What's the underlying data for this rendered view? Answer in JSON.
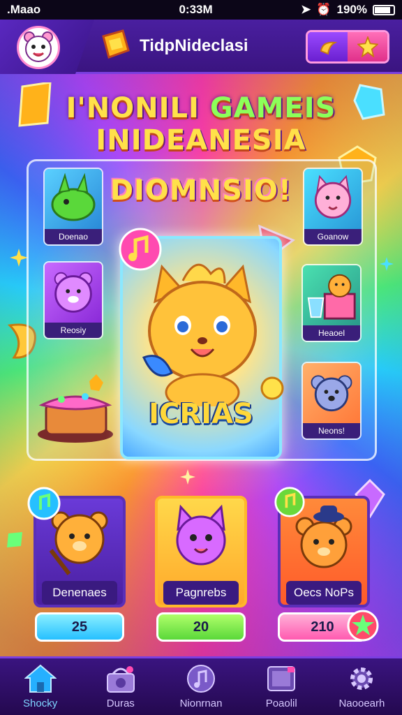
{
  "status_bar": {
    "carrier": ".Maao",
    "time": "0:33M",
    "battery": "190%"
  },
  "header": {
    "title": "TidpNideclasi"
  },
  "banner": {
    "line1_a": "I'NONILI ",
    "line1_b": "GAMEIS",
    "line2": "INIDEANESIA",
    "line3": "DIOMNSIO!"
  },
  "side_cards": [
    {
      "label": "Doenao",
      "image": "green-dragon"
    },
    {
      "label": "Reosiy",
      "image": "purple-bear"
    },
    {
      "label": "Goanow",
      "image": "pink-cat"
    },
    {
      "label": "Heaoel",
      "image": "bear-box"
    },
    {
      "label": "Neons!",
      "image": "blue-koala"
    }
  ],
  "hero": {
    "label": "ICRIAS",
    "image": "golden-cat"
  },
  "game_cards": [
    {
      "label": "Denenaes",
      "score": "25",
      "image": "bear-brush"
    },
    {
      "label": "Pagnrebs",
      "score": "20",
      "image": "purple-cat"
    },
    {
      "label": "Oecs NoPs",
      "score": "210",
      "image": "bear-hat"
    }
  ],
  "bottom_nav": [
    {
      "label": "Shocky",
      "icon": "home-icon",
      "active": true
    },
    {
      "label": "Duras",
      "icon": "basket-icon",
      "active": false
    },
    {
      "label": "Nionrnan",
      "icon": "music-icon",
      "active": false
    },
    {
      "label": "Poaolil",
      "icon": "photo-icon",
      "active": false
    },
    {
      "label": "Naooearh",
      "icon": "gear-icon",
      "active": false
    }
  ],
  "colors": {
    "header_bg": "#4a1fa0",
    "nav_active": "#7fd6ff",
    "banner_yellow": "#ffe14a",
    "banner_green": "#8cff5a"
  }
}
